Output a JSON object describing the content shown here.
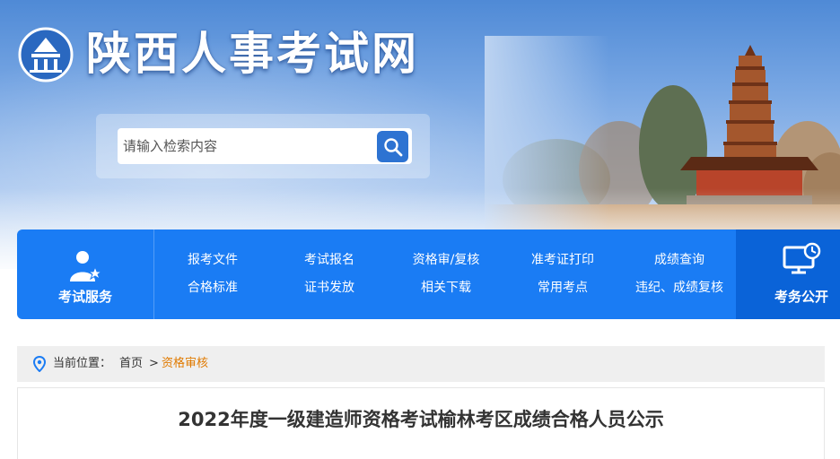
{
  "header": {
    "site_title": "陕西人事考试网"
  },
  "search": {
    "placeholder": "请输入检索内容",
    "value": ""
  },
  "nav": {
    "left_label": "考试服务",
    "right_label": "考务公开",
    "links": [
      [
        "报考文件",
        "考试报名",
        "资格审/复核",
        "准考证打印",
        "成绩查询"
      ],
      [
        "合格标准",
        "证书发放",
        "相关下载",
        "常用考点",
        "违纪、成绩复核"
      ]
    ]
  },
  "breadcrumb": {
    "prefix": "当前位置：",
    "home": "首页",
    "separator": ">",
    "current": "资格审核"
  },
  "article": {
    "title": "2022年度一级建造师资格考试榆林考区成绩合格人员公示"
  },
  "colors": {
    "nav_blue": "#1a7cf4",
    "nav_dark": "#0a63d8",
    "breadcrumb_current": "#e07a00"
  },
  "icons": [
    "logo-emblem",
    "search-icon",
    "exam-service-icon",
    "monitor-clock-icon",
    "location-pin-icon"
  ]
}
